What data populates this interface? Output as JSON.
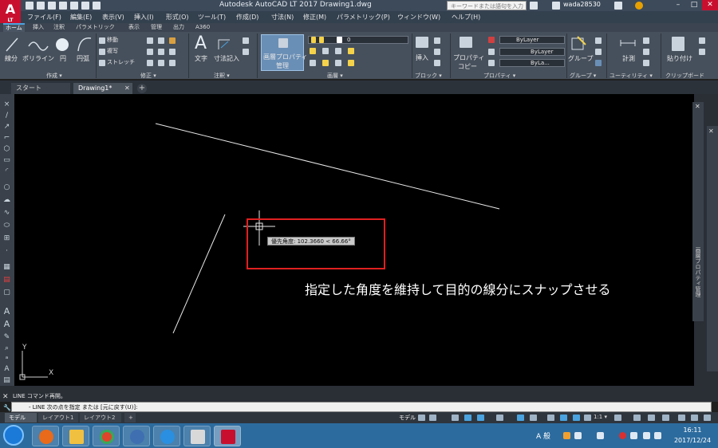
{
  "app": {
    "logo_text": "A",
    "logo_sub": "LT",
    "title": "Autodesk AutoCAD LT 2017    Drawing1.dwg",
    "search_placeholder": "キーワードまたは語句を入力",
    "user": "wada28530"
  },
  "window_buttons": [
    "–",
    "□",
    "✕"
  ],
  "menu": [
    "ファイル(F)",
    "編集(E)",
    "表示(V)",
    "挿入(I)",
    "形式(O)",
    "ツール(T)",
    "作成(D)",
    "寸法(N)",
    "修正(M)",
    "パラメトリック(P)",
    "ウィンドウ(W)",
    "ヘルプ(H)"
  ],
  "ribbon_tabs": [
    "ホーム",
    "挿入",
    "注釈",
    "パラメトリック",
    "表示",
    "管理",
    "出力",
    "A360"
  ],
  "ribbon": {
    "draw_tools": [
      "線分",
      "ポリライン",
      "円",
      "円弧"
    ],
    "modify_tools": [
      "移動",
      "複写",
      "ストレッチ"
    ],
    "annotation_tools": [
      "文字",
      "寸法記入"
    ],
    "layer_props_label": "画層プロパティ",
    "layer_props_label2": "管理",
    "layer_value": "0",
    "insert_label": "挿入",
    "match_props_label": "プロパティ",
    "match_props_label2": "コピー",
    "prop_color": "ByLayer",
    "prop_linetype": "ByLayer",
    "prop_lineweight": "ByLa...",
    "group_label": "グループ",
    "measure_label": "計測",
    "paste_label": "貼り付け",
    "panels": [
      "作成 ▾",
      "修正 ▾",
      "注釈 ▾",
      "画層 ▾",
      "ブロック ▾",
      "プロパティ ▾",
      "グループ ▾",
      "ユーティリティ ▾",
      "クリップボード"
    ]
  },
  "doc_tabs": {
    "start": "スタート",
    "drawing": "Drawing1*",
    "add": "+"
  },
  "canvas": {
    "tooltip": "優先角度: 102.3660 < 66.66°",
    "annotation": "指定した角度を維持して目的の線分にスナップさせる",
    "axis_y": "Y",
    "axis_x": "X"
  },
  "right_panel": {
    "label": "画層プロパティ管理"
  },
  "command": {
    "history": "LINE コマンド再開。",
    "prompt": "- LINE 次の点を指定 または [元に戻す(U)]:",
    "close": "✕"
  },
  "layout_tabs": [
    "モデル",
    "レイアウト1",
    "レイアウト2",
    "+"
  ],
  "status": {
    "model": "モデル",
    "scale": "1:1 ▾"
  },
  "taskbar": {
    "ime": "A 般",
    "time": "16:11",
    "date": "2017/12/24"
  },
  "colors": {
    "accent": "#4aa3df",
    "red_box": "#e02020",
    "canvas": "#000000"
  }
}
